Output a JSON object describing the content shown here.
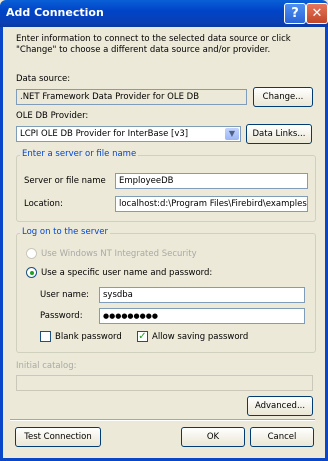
{
  "window": {
    "title": "Add Connection",
    "help_glyph": "?",
    "close_glyph": "✕"
  },
  "intro_line1": "Enter information to connect to the selected data source or click",
  "intro_line2": "\"Change\" to choose a different data source and/or provider.",
  "data_source": {
    "label": "Data source:",
    "value": ".NET Framework Data Provider for OLE DB",
    "change_button": "Change..."
  },
  "provider": {
    "label": "OLE DB Provider:",
    "value": "LCPI OLE DB Provider for InterBase [v3]",
    "data_links_button": "Data Links..."
  },
  "server_group": {
    "title": "Enter a server or file name",
    "server_label": "Server or file name",
    "server_value": "EmployeeDB",
    "location_label": "Location:",
    "location_value": "localhost:d:\\Program Files\\Firebird\\examples\\"
  },
  "logon_group": {
    "title": "Log on to the server",
    "windows_auth_label": "Use Windows NT Integrated Security",
    "specific_auth_label": "Use a specific user name and password:",
    "username_label": "User name:",
    "username_value": "sysdba",
    "password_label": "Password:",
    "password_value": "●●●●●●●●●",
    "blank_password_label": "Blank password",
    "allow_saving_label": "Allow saving password"
  },
  "catalog": {
    "label": "Initial catalog:"
  },
  "buttons": {
    "advanced": "Advanced...",
    "test": "Test Connection",
    "ok": "OK",
    "cancel": "Cancel"
  }
}
